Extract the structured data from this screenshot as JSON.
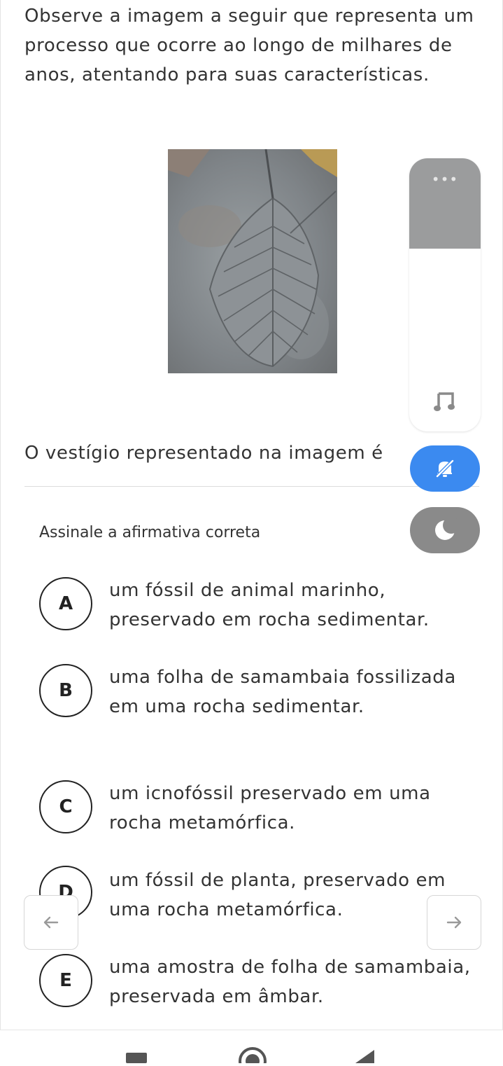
{
  "intro_text": "Observe a imagem a seguir que representa um processo que ocorre ao longo de milhares de anos, atentando para suas características.",
  "question_text": "O vestígio representado na imagem é",
  "instruction": "Assinale a afirmativa correta",
  "options": [
    {
      "letter": "A",
      "text": "um fóssil de animal marinho, preservado em rocha sedimentar."
    },
    {
      "letter": "B",
      "text": "uma folha de samambaia fossilizada em uma rocha sedimentar."
    },
    {
      "letter": "C",
      "text": "um icnofóssil preservado em uma rocha metamórfica."
    },
    {
      "letter": "D",
      "text": "um fóssil de planta, preservado em uma rocha metamórfica."
    },
    {
      "letter": "E",
      "text": "uma amostra de folha de samambaia, preservada em âmbar."
    }
  ],
  "side_panel": {
    "menu_dots": "•••"
  },
  "icons": {
    "prev": "arrow-left-icon",
    "next": "arrow-right-icon",
    "music": "music-note-icon",
    "mute": "bell-off-icon",
    "dark_mode": "moon-icon"
  },
  "colors": {
    "accent_blue": "#3b8af0",
    "panel_gray": "#9b9c9d",
    "pill_gray": "#8a8a8a"
  }
}
